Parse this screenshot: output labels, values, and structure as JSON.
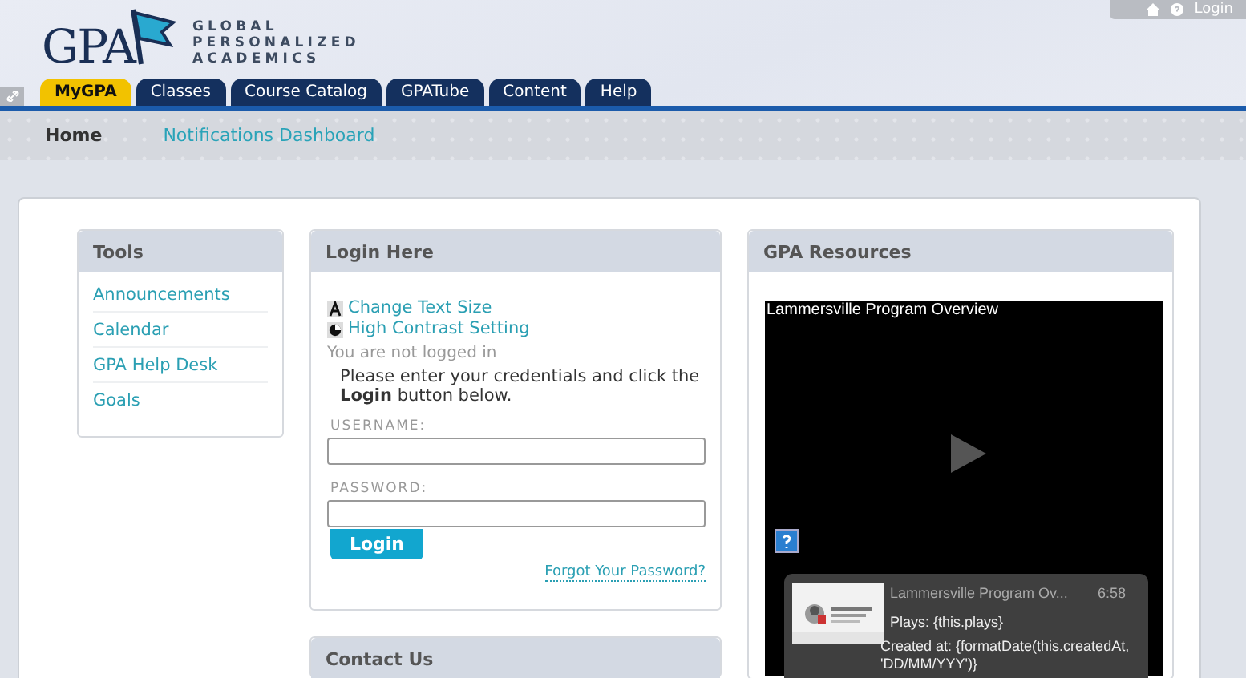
{
  "top_bar": {
    "login": "Login"
  },
  "logo": {
    "mark": "GPA",
    "lines": [
      "GLOBAL",
      "PERSONALIZED",
      "ACADEMICS"
    ]
  },
  "tabs": [
    {
      "label": "MyGPA",
      "selected": true
    },
    {
      "label": "Classes",
      "selected": false
    },
    {
      "label": "Course Catalog",
      "selected": false
    },
    {
      "label": "GPATube",
      "selected": false
    },
    {
      "label": "Content",
      "selected": false
    },
    {
      "label": "Help",
      "selected": false
    }
  ],
  "subnav": [
    {
      "label": "Home",
      "selected": true
    },
    {
      "label": "Notifications Dashboard",
      "selected": false
    }
  ],
  "tools": {
    "title": "Tools",
    "items": [
      "Announcements",
      "Calendar",
      "GPA Help Desk",
      "Goals"
    ]
  },
  "login": {
    "title": "Login Here",
    "links": [
      {
        "kind": "text-size",
        "label": "Change Text Size"
      },
      {
        "kind": "contrast",
        "label": "High Contrast Setting"
      }
    ],
    "status": "You are not logged in",
    "instructions": "Please enter your credentials and click the **Login** button below.",
    "username_label": "USERNAME:",
    "password_label": "PASSWORD:",
    "button": "Login",
    "forgot": "Forgot Your Password?"
  },
  "contact": {
    "title": "Contact Us"
  },
  "resources": {
    "title": "GPA Resources",
    "video": {
      "title": "Lammersville Program Overview",
      "card": {
        "title": "Lammersville Program Ov...",
        "duration": "6:58",
        "plays": "Plays: {this.plays}",
        "created": "Created at: {formatDate(this.createdAt, 'DD/MM/YYY')}"
      }
    }
  }
}
